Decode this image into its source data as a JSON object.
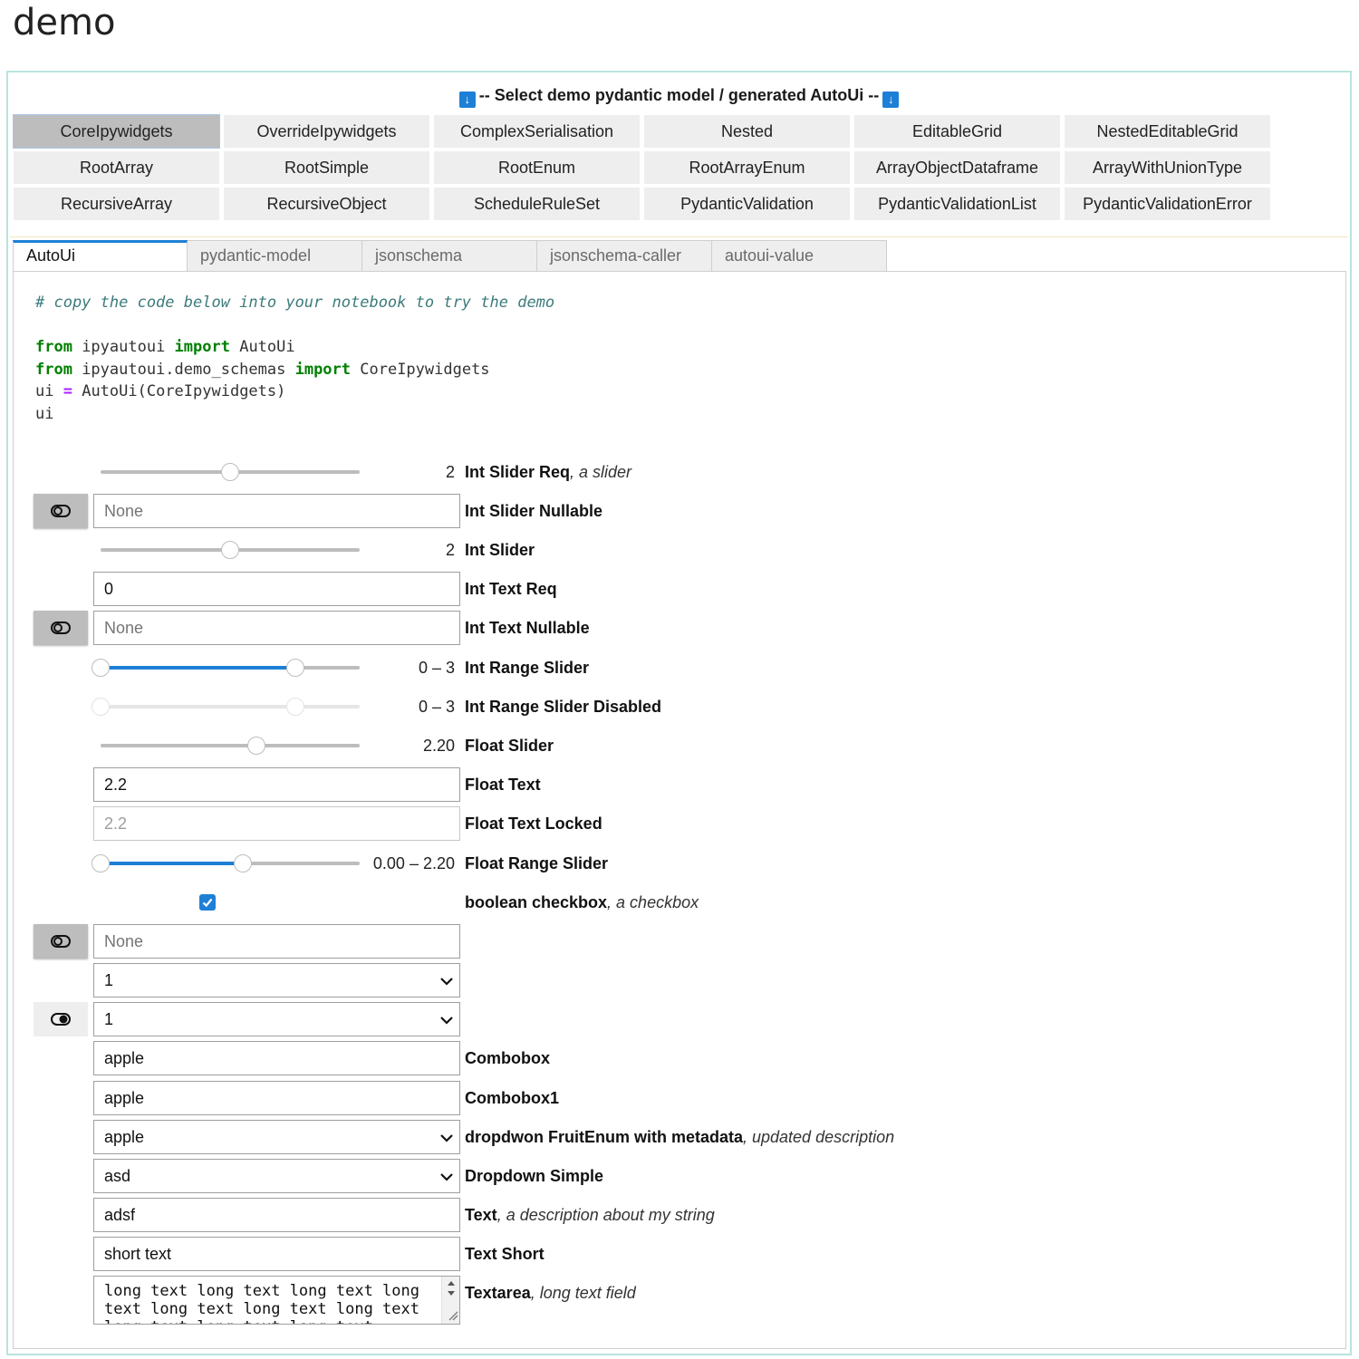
{
  "page": {
    "title": "demo"
  },
  "selector": {
    "header": "-- Select demo pydantic model / generated AutoUi --",
    "buttons": [
      "CoreIpywidgets",
      "OverrideIpywidgets",
      "ComplexSerialisation",
      "Nested",
      "EditableGrid",
      "NestedEditableGrid",
      "RootArray",
      "RootSimple",
      "RootEnum",
      "RootArrayEnum",
      "ArrayObjectDataframe",
      "ArrayWithUnionType",
      "RecursiveArray",
      "RecursiveObject",
      "ScheduleRuleSet",
      "PydanticValidation",
      "PydanticValidationList",
      "PydanticValidationError"
    ],
    "active": "CoreIpywidgets"
  },
  "tabs": [
    "AutoUi",
    "pydantic-model",
    "jsonschema",
    "jsonschema-caller",
    "autoui-value"
  ],
  "code": {
    "comment": "# copy the code below into your notebook to try the demo",
    "kw_from": "from",
    "kw_import": "import",
    "mod1": " ipyautoui ",
    "name1": " AutoUi",
    "mod2": " ipyautoui.demo_schemas ",
    "name2": " CoreIpywidgets",
    "line3_a": "ui ",
    "line3_op": "=",
    "line3_b": " AutoUi(CoreIpywidgets)",
    "line4": "ui"
  },
  "form": {
    "int_slider_req": {
      "label": "Int Slider Req",
      "desc": ", a slider",
      "value": "2",
      "level": 0.5
    },
    "int_slider_nullable": {
      "label": "Int Slider Nullable",
      "placeholder": "None"
    },
    "int_slider": {
      "label": "Int Slider",
      "value": "2",
      "level": 0.5
    },
    "int_text_req": {
      "label": "Int Text Req",
      "value": "0"
    },
    "int_text_nullable": {
      "label": "Int Text Nullable",
      "placeholder": "None"
    },
    "int_range_slider": {
      "label": "Int Range Slider",
      "value": "0 – 3",
      "low": 0,
      "high": 0.75
    },
    "int_range_slider_disabled": {
      "label": "Int Range Slider Disabled",
      "value": "0 – 3",
      "low": 0,
      "high": 0.75
    },
    "float_slider": {
      "label": "Float Slider",
      "value": "2.20",
      "level": 0.6
    },
    "float_text": {
      "label": "Float Text",
      "value": "2.2"
    },
    "float_text_locked": {
      "label": "Float Text Locked",
      "value": "2.2"
    },
    "float_range_slider": {
      "label": "Float Range Slider",
      "value": "0.00 – 2.20",
      "low": 0,
      "high": 0.55
    },
    "boolean_checkbox": {
      "label": "boolean checkbox",
      "desc": ", a checkbox",
      "checked": true
    },
    "nullable_none": {
      "placeholder": "None"
    },
    "select_a": {
      "value": "1"
    },
    "select_b": {
      "value": "1"
    },
    "combobox": {
      "label": "Combobox",
      "value": "apple"
    },
    "combobox1": {
      "label": "Combobox1",
      "value": "apple"
    },
    "dropdown_fruit": {
      "label": "dropdwon FruitEnum with metadata",
      "desc": ", updated description",
      "value": "apple"
    },
    "dropdown_simple": {
      "label": "Dropdown Simple",
      "value": "asd"
    },
    "text": {
      "label": "Text",
      "desc": ", a description about my string",
      "value": "adsf"
    },
    "text_short": {
      "label": "Text Short",
      "value": "short text"
    },
    "textarea": {
      "label": "Textarea",
      "desc": ", long text field",
      "value": "long text long text long text long text long text long text long text long text long text long text"
    }
  },
  "colors": {
    "accent": "#1e7fd6",
    "border": "#b9e4de",
    "button_bg": "#eeeeee",
    "active_button_bg": "#bdbdbd"
  }
}
